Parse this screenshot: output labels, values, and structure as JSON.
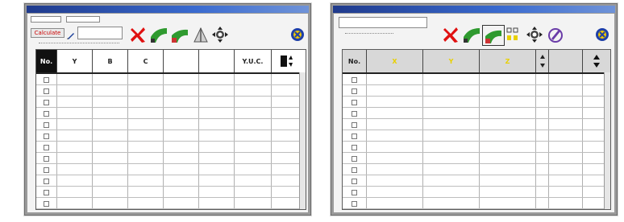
{
  "left_window": {
    "title": "",
    "calculate_label": "Calculate",
    "field_value": "",
    "table_header": {
      "no": "No.",
      "y": "Y",
      "b": "B",
      "c": "C",
      "yuc": "Y.U.C."
    },
    "rows": 12
  },
  "right_window": {
    "title": "",
    "table_header": {
      "no": "No.",
      "x": "X",
      "y": "Y",
      "z": "Z",
      "mode": ""
    },
    "rows": 12
  },
  "colors": {
    "title_bar": "#1f3a8c",
    "red_x": "#e01010",
    "green_tool": "#2f9a2f",
    "close_button": "#1e3fa8",
    "yellow_header": "#e8d000"
  },
  "icons": [
    "cancel-icon",
    "green-curve-icon",
    "green-flag-icon",
    "triangle-icon",
    "navigation-pad-icon",
    "close-circle-icon",
    "pen-icon",
    "scroll-arrows-icon"
  ]
}
